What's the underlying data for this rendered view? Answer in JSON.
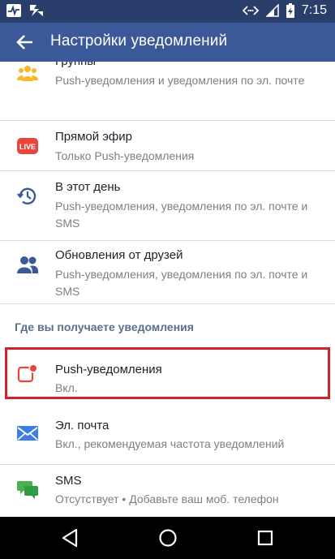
{
  "status_bar": {
    "time": "7:15"
  },
  "app_bar": {
    "title": "Настройки уведомлений"
  },
  "settings": [
    {
      "title": "Группы",
      "sub": "Push-уведомления и уведомления по эл. почте",
      "icon": "groups-icon"
    },
    {
      "title": "Прямой эфир",
      "sub": "Только Push-уведомления",
      "icon": "live-icon"
    },
    {
      "title": "В этот день",
      "sub": "Push-уведомления, уведомления по эл. почте и SMS",
      "icon": "history-icon"
    },
    {
      "title": "Обновления от друзей",
      "sub": "Push-уведомления, уведомления по эл. почте и SMS",
      "icon": "friends-icon"
    }
  ],
  "section_header": "Где вы получаете уведомления",
  "channels": [
    {
      "title": "Push-уведомления",
      "sub": "Вкл.",
      "icon": "push-notification-icon"
    },
    {
      "title": "Эл. почта",
      "sub": "Вкл., рекомендуемая частота уведомлений",
      "icon": "mail-icon"
    },
    {
      "title": "SMS",
      "sub": "Отсутствует • Добавьте ваш моб. телефон",
      "icon": "sms-icon"
    }
  ],
  "live_badge": "LIVE",
  "colors": {
    "brand": "#3b5998",
    "status_bar": "#293e6a",
    "highlight": "#d2232a",
    "warning": "#e0333c",
    "section": "#5a6f8d"
  }
}
